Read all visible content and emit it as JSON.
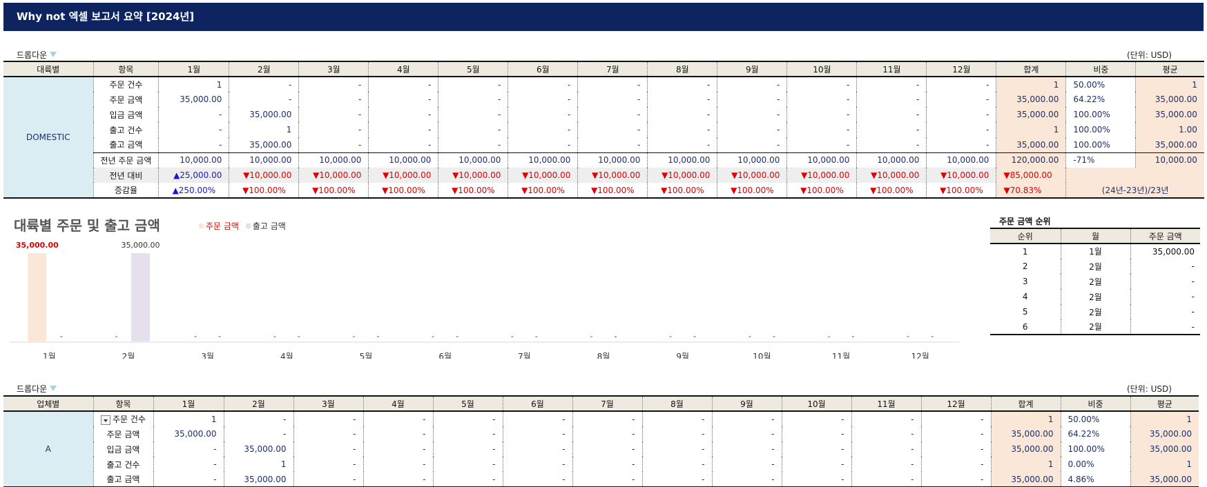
{
  "title": "Why not 엑셀 보고서 요약 [2024년]",
  "dropdown_label": "드롭다운",
  "unit_label": "(단위: USD)",
  "months": [
    "1월",
    "2월",
    "3월",
    "4월",
    "5월",
    "6월",
    "7월",
    "8월",
    "9월",
    "10월",
    "11월",
    "12월"
  ],
  "table1": {
    "headers": {
      "group": "대륙별",
      "item": "항목",
      "total": "합계",
      "share": "비중",
      "avg": "평균"
    },
    "group_name": "DOMESTIC",
    "rows": [
      {
        "label": "주문 건수",
        "values": [
          "1",
          "-",
          "-",
          "-",
          "-",
          "-",
          "-",
          "-",
          "-",
          "-",
          "-",
          "-"
        ],
        "total": "1",
        "share": "50.00%",
        "avg": "1"
      },
      {
        "label": "주문 금액",
        "values": [
          "35,000.00",
          "-",
          "-",
          "-",
          "-",
          "-",
          "-",
          "-",
          "-",
          "-",
          "-",
          "-"
        ],
        "total": "35,000.00",
        "share": "64.22%",
        "avg": "35,000.00"
      },
      {
        "label": "입금 금액",
        "values": [
          "-",
          "35,000.00",
          "-",
          "-",
          "-",
          "-",
          "-",
          "-",
          "-",
          "-",
          "-",
          "-"
        ],
        "total": "35,000.00",
        "share": "100.00%",
        "avg": "35,000.00"
      },
      {
        "label": "출고 건수",
        "values": [
          "-",
          "1",
          "-",
          "-",
          "-",
          "-",
          "-",
          "-",
          "-",
          "-",
          "-",
          "-"
        ],
        "total": "1",
        "share": "100.00%",
        "avg": "1.00"
      },
      {
        "label": "출고 금액",
        "values": [
          "-",
          "35,000.00",
          "-",
          "-",
          "-",
          "-",
          "-",
          "-",
          "-",
          "-",
          "-",
          "-"
        ],
        "total": "35,000.00",
        "share": "100.00%",
        "avg": "35,000.00"
      }
    ],
    "prev_row": {
      "label": "전년 주문 금액",
      "values": [
        "10,000.00",
        "10,000.00",
        "10,000.00",
        "10,000.00",
        "10,000.00",
        "10,000.00",
        "10,000.00",
        "10,000.00",
        "10,000.00",
        "10,000.00",
        "10,000.00",
        "10,000.00"
      ],
      "total": "120,000.00",
      "share": "-71%",
      "avg": "10,000.00"
    },
    "diff_row": {
      "label": "전년 대비",
      "values": [
        "▲25,000.00",
        "▼10,000.00",
        "▼10,000.00",
        "▼10,000.00",
        "▼10,000.00",
        "▼10,000.00",
        "▼10,000.00",
        "▼10,000.00",
        "▼10,000.00",
        "▼10,000.00",
        "▼10,000.00",
        "▼10,000.00"
      ],
      "total": "▼85,000.00"
    },
    "rate_row": {
      "label": "증감율",
      "values": [
        "▲250.00%",
        "▼100.00%",
        "▼100.00%",
        "▼100.00%",
        "▼100.00%",
        "▼100.00%",
        "▼100.00%",
        "▼100.00%",
        "▼100.00%",
        "▼100.00%",
        "▼100.00%",
        "▼100.00%"
      ],
      "total": "▼70.83%",
      "note": "(24년-23년)/23년"
    }
  },
  "chart": {
    "title": "대륙별 주문 및 출고 금액",
    "legend_order": "주문 금액",
    "legend_ship": "출고 금액",
    "label_dash": "-",
    "color_order": "#fbe7d8",
    "color_ship": "#e6e0ee",
    "color_order_label": "#e00000",
    "color_ship_label": "#333333"
  },
  "chart_data": {
    "type": "bar",
    "categories": [
      "1월",
      "2월",
      "3월",
      "4월",
      "5월",
      "6월",
      "7월",
      "8월",
      "9월",
      "10월",
      "11월",
      "12월"
    ],
    "series": [
      {
        "name": "주문 금액",
        "values": [
          35000,
          0,
          0,
          0,
          0,
          0,
          0,
          0,
          0,
          0,
          0,
          0
        ]
      },
      {
        "name": "출고 금액",
        "values": [
          0,
          35000,
          0,
          0,
          0,
          0,
          0,
          0,
          0,
          0,
          0,
          0
        ]
      }
    ],
    "value_labels": {
      "주문 금액": [
        "35,000.00",
        "-",
        "-",
        "-",
        "-",
        "-",
        "-",
        "-",
        "-",
        "-",
        "-",
        "-"
      ],
      "출고 금액": [
        "-",
        "35,000.00",
        "-",
        "-",
        "-",
        "-",
        "-",
        "-",
        "-",
        "-",
        "-",
        "-"
      ]
    },
    "ylim": [
      0,
      35000
    ],
    "title": "대륙별 주문 및 출고 금액"
  },
  "rank": {
    "title": "주문 금액 순위",
    "headers": [
      "순위",
      "월",
      "주문 금액"
    ],
    "rows": [
      [
        "1",
        "1월",
        "35,000.00"
      ],
      [
        "2",
        "2월",
        "-"
      ],
      [
        "3",
        "2월",
        "-"
      ],
      [
        "4",
        "2월",
        "-"
      ],
      [
        "5",
        "2월",
        "-"
      ],
      [
        "6",
        "2월",
        "-"
      ]
    ]
  },
  "table2": {
    "headers": {
      "group": "업체별",
      "item": "항목",
      "total": "합계",
      "share": "비중",
      "avg": "평균"
    },
    "group_name": "A",
    "rows": [
      {
        "label": "주문 건수",
        "values": [
          "1",
          "-",
          "-",
          "-",
          "-",
          "-",
          "-",
          "-",
          "-",
          "-",
          "-",
          "-"
        ],
        "total": "1",
        "share": "50.00%",
        "avg": "1"
      },
      {
        "label": "주문 금액",
        "values": [
          "35,000.00",
          "-",
          "-",
          "-",
          "-",
          "-",
          "-",
          "-",
          "-",
          "-",
          "-",
          "-"
        ],
        "total": "35,000.00",
        "share": "64.22%",
        "avg": "35,000.00"
      },
      {
        "label": "입금 금액",
        "values": [
          "-",
          "35,000.00",
          "-",
          "-",
          "-",
          "-",
          "-",
          "-",
          "-",
          "-",
          "-",
          "-"
        ],
        "total": "35,000.00",
        "share": "100.00%",
        "avg": "35,000.00"
      },
      {
        "label": "출고 건수",
        "values": [
          "-",
          "1",
          "-",
          "-",
          "-",
          "-",
          "-",
          "-",
          "-",
          "-",
          "-",
          "-"
        ],
        "total": "1",
        "share": "0.00%",
        "avg": "1"
      },
      {
        "label": "출고 금액",
        "values": [
          "-",
          "35,000.00",
          "-",
          "-",
          "-",
          "-",
          "-",
          "-",
          "-",
          "-",
          "-",
          "-"
        ],
        "total": "35,000.00",
        "share": "4.86%",
        "avg": "35,000.00"
      }
    ]
  }
}
